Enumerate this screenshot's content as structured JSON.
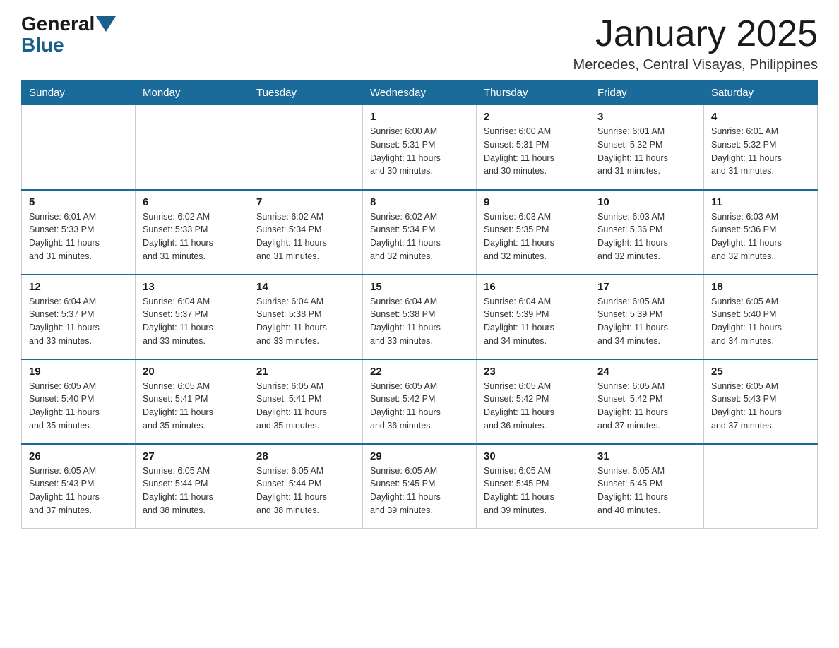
{
  "header": {
    "logo_text_general": "General",
    "logo_text_blue": "Blue",
    "title": "January 2025",
    "subtitle": "Mercedes, Central Visayas, Philippines"
  },
  "weekdays": [
    "Sunday",
    "Monday",
    "Tuesday",
    "Wednesday",
    "Thursday",
    "Friday",
    "Saturday"
  ],
  "weeks": [
    [
      {
        "day": "",
        "info": ""
      },
      {
        "day": "",
        "info": ""
      },
      {
        "day": "",
        "info": ""
      },
      {
        "day": "1",
        "info": "Sunrise: 6:00 AM\nSunset: 5:31 PM\nDaylight: 11 hours\nand 30 minutes."
      },
      {
        "day": "2",
        "info": "Sunrise: 6:00 AM\nSunset: 5:31 PM\nDaylight: 11 hours\nand 30 minutes."
      },
      {
        "day": "3",
        "info": "Sunrise: 6:01 AM\nSunset: 5:32 PM\nDaylight: 11 hours\nand 31 minutes."
      },
      {
        "day": "4",
        "info": "Sunrise: 6:01 AM\nSunset: 5:32 PM\nDaylight: 11 hours\nand 31 minutes."
      }
    ],
    [
      {
        "day": "5",
        "info": "Sunrise: 6:01 AM\nSunset: 5:33 PM\nDaylight: 11 hours\nand 31 minutes."
      },
      {
        "day": "6",
        "info": "Sunrise: 6:02 AM\nSunset: 5:33 PM\nDaylight: 11 hours\nand 31 minutes."
      },
      {
        "day": "7",
        "info": "Sunrise: 6:02 AM\nSunset: 5:34 PM\nDaylight: 11 hours\nand 31 minutes."
      },
      {
        "day": "8",
        "info": "Sunrise: 6:02 AM\nSunset: 5:34 PM\nDaylight: 11 hours\nand 32 minutes."
      },
      {
        "day": "9",
        "info": "Sunrise: 6:03 AM\nSunset: 5:35 PM\nDaylight: 11 hours\nand 32 minutes."
      },
      {
        "day": "10",
        "info": "Sunrise: 6:03 AM\nSunset: 5:36 PM\nDaylight: 11 hours\nand 32 minutes."
      },
      {
        "day": "11",
        "info": "Sunrise: 6:03 AM\nSunset: 5:36 PM\nDaylight: 11 hours\nand 32 minutes."
      }
    ],
    [
      {
        "day": "12",
        "info": "Sunrise: 6:04 AM\nSunset: 5:37 PM\nDaylight: 11 hours\nand 33 minutes."
      },
      {
        "day": "13",
        "info": "Sunrise: 6:04 AM\nSunset: 5:37 PM\nDaylight: 11 hours\nand 33 minutes."
      },
      {
        "day": "14",
        "info": "Sunrise: 6:04 AM\nSunset: 5:38 PM\nDaylight: 11 hours\nand 33 minutes."
      },
      {
        "day": "15",
        "info": "Sunrise: 6:04 AM\nSunset: 5:38 PM\nDaylight: 11 hours\nand 33 minutes."
      },
      {
        "day": "16",
        "info": "Sunrise: 6:04 AM\nSunset: 5:39 PM\nDaylight: 11 hours\nand 34 minutes."
      },
      {
        "day": "17",
        "info": "Sunrise: 6:05 AM\nSunset: 5:39 PM\nDaylight: 11 hours\nand 34 minutes."
      },
      {
        "day": "18",
        "info": "Sunrise: 6:05 AM\nSunset: 5:40 PM\nDaylight: 11 hours\nand 34 minutes."
      }
    ],
    [
      {
        "day": "19",
        "info": "Sunrise: 6:05 AM\nSunset: 5:40 PM\nDaylight: 11 hours\nand 35 minutes."
      },
      {
        "day": "20",
        "info": "Sunrise: 6:05 AM\nSunset: 5:41 PM\nDaylight: 11 hours\nand 35 minutes."
      },
      {
        "day": "21",
        "info": "Sunrise: 6:05 AM\nSunset: 5:41 PM\nDaylight: 11 hours\nand 35 minutes."
      },
      {
        "day": "22",
        "info": "Sunrise: 6:05 AM\nSunset: 5:42 PM\nDaylight: 11 hours\nand 36 minutes."
      },
      {
        "day": "23",
        "info": "Sunrise: 6:05 AM\nSunset: 5:42 PM\nDaylight: 11 hours\nand 36 minutes."
      },
      {
        "day": "24",
        "info": "Sunrise: 6:05 AM\nSunset: 5:42 PM\nDaylight: 11 hours\nand 37 minutes."
      },
      {
        "day": "25",
        "info": "Sunrise: 6:05 AM\nSunset: 5:43 PM\nDaylight: 11 hours\nand 37 minutes."
      }
    ],
    [
      {
        "day": "26",
        "info": "Sunrise: 6:05 AM\nSunset: 5:43 PM\nDaylight: 11 hours\nand 37 minutes."
      },
      {
        "day": "27",
        "info": "Sunrise: 6:05 AM\nSunset: 5:44 PM\nDaylight: 11 hours\nand 38 minutes."
      },
      {
        "day": "28",
        "info": "Sunrise: 6:05 AM\nSunset: 5:44 PM\nDaylight: 11 hours\nand 38 minutes."
      },
      {
        "day": "29",
        "info": "Sunrise: 6:05 AM\nSunset: 5:45 PM\nDaylight: 11 hours\nand 39 minutes."
      },
      {
        "day": "30",
        "info": "Sunrise: 6:05 AM\nSunset: 5:45 PM\nDaylight: 11 hours\nand 39 minutes."
      },
      {
        "day": "31",
        "info": "Sunrise: 6:05 AM\nSunset: 5:45 PM\nDaylight: 11 hours\nand 40 minutes."
      },
      {
        "day": "",
        "info": ""
      }
    ]
  ]
}
